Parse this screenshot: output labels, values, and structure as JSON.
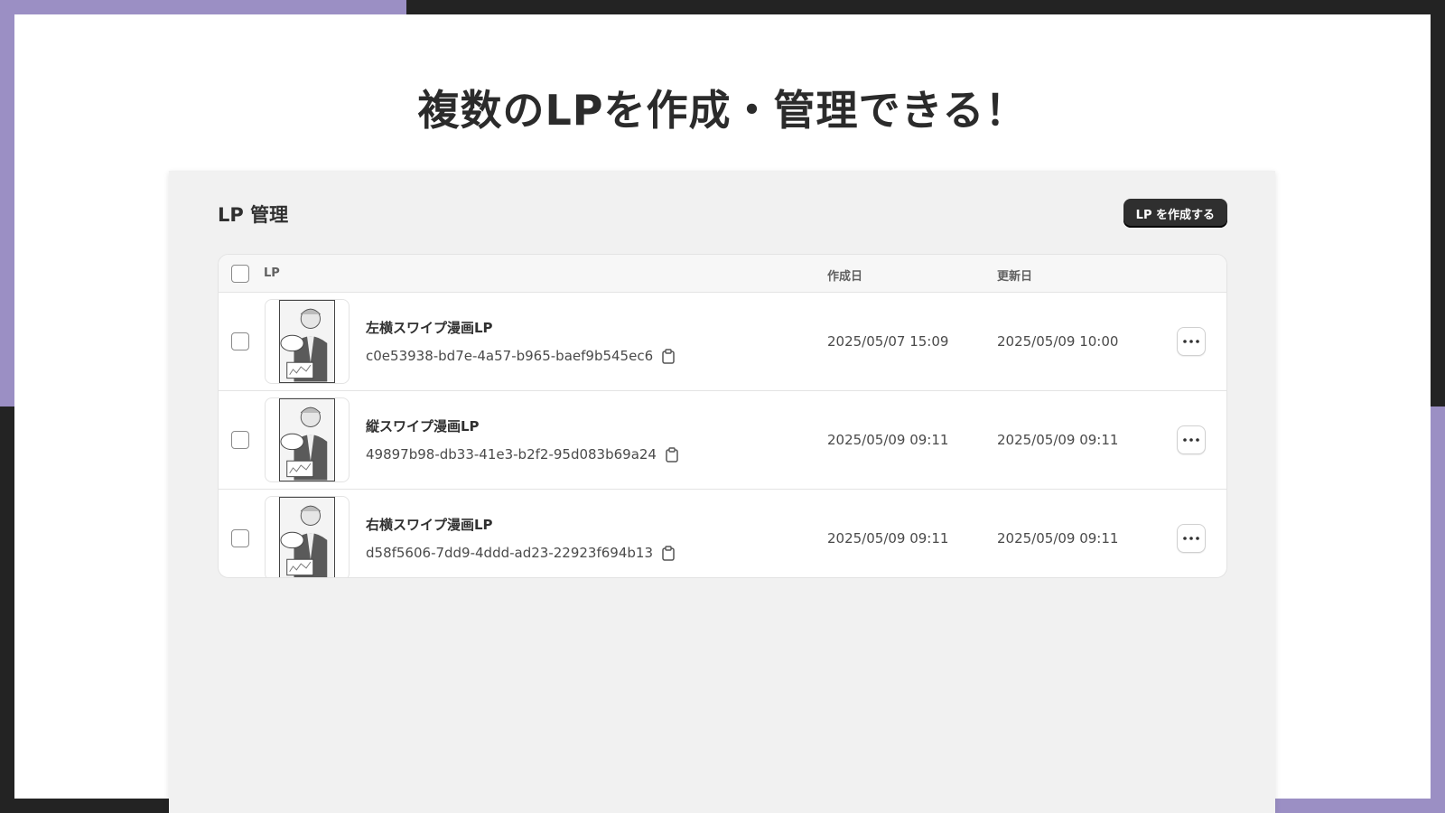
{
  "headline": "複数のLPを作成・管理できる！",
  "panel": {
    "title": "LP 管理",
    "create_button": "LP を作成する"
  },
  "table": {
    "headers": {
      "lp": "LP",
      "created": "作成日",
      "updated": "更新日"
    },
    "rows": [
      {
        "title": "左横スワイプ漫画LP",
        "id": "c0e53938-bd7e-4a57-b965-baef9b545ec6",
        "created": "2025/05/07 15:09",
        "updated": "2025/05/09 10:00"
      },
      {
        "title": "縦スワイプ漫画LP",
        "id": "49897b98-db33-41e3-b2f2-95d083b69a24",
        "created": "2025/05/09 09:11",
        "updated": "2025/05/09 09:11"
      },
      {
        "title": "右横スワイプ漫画LP",
        "id": "d58f5606-7dd9-4ddd-ad23-22923f694b13",
        "created": "2025/05/09 09:11",
        "updated": "2025/05/09 09:11"
      }
    ]
  },
  "icons": {
    "copy": "clipboard-icon",
    "more": "more-horizontal-icon",
    "thumbnail": "manga-thumbnail"
  },
  "colors": {
    "accent": "#9b8fc4",
    "frame": "#232323",
    "button": "#2f2f2f"
  }
}
